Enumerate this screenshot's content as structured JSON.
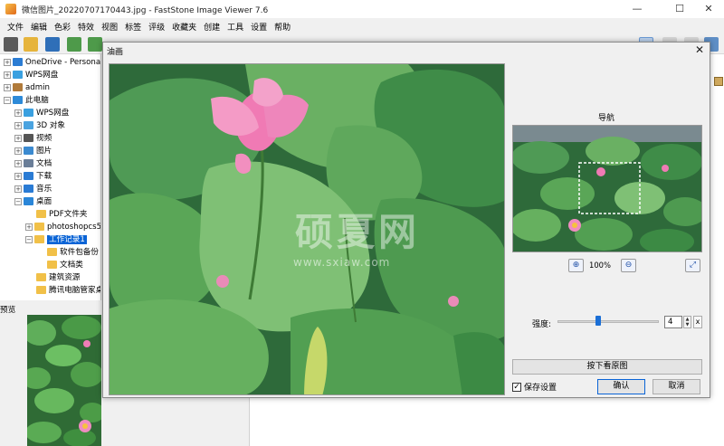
{
  "window": {
    "title": "微信图片_20220707170443.jpg  -  FastStone Image Viewer 7.6",
    "minimize": "—",
    "maximize": "☐",
    "close": "✕"
  },
  "menu": [
    "文件",
    "编辑",
    "色彩",
    "特效",
    "视图",
    "标签",
    "评级",
    "收藏夹",
    "创建",
    "工具",
    "设置",
    "帮助"
  ],
  "tree": [
    {
      "label": "OneDrive - Personal",
      "exp": "+",
      "icon": "cloud-icon",
      "color": "#2b7cd3"
    },
    {
      "label": "WPS网盘",
      "exp": "+",
      "icon": "cloud-icon",
      "color": "#3aa0e0"
    },
    {
      "label": "admin",
      "exp": "+",
      "icon": "user-icon",
      "color": "#b07a3a"
    },
    {
      "label": "此电脑",
      "exp": "−",
      "icon": "computer-icon",
      "color": "#2d8ad8"
    },
    {
      "label": "WPS网盘",
      "exp": "+",
      "icon": "cloud-icon",
      "color": "#3aa0e0"
    },
    {
      "label": "3D 对象",
      "exp": "+",
      "icon": "cube-icon",
      "color": "#4aa3e0"
    },
    {
      "label": "视频",
      "exp": "+",
      "icon": "film-icon",
      "color": "#555555"
    },
    {
      "label": "图片",
      "exp": "+",
      "icon": "picture-icon",
      "color": "#3b8ad0"
    },
    {
      "label": "文档",
      "exp": "+",
      "icon": "document-icon",
      "color": "#6a7e98"
    },
    {
      "label": "下载",
      "exp": "+",
      "icon": "download-icon",
      "color": "#2a7bd4"
    },
    {
      "label": "音乐",
      "exp": "+",
      "icon": "music-icon",
      "color": "#2a7bd4"
    },
    {
      "label": "桌面",
      "exp": "−",
      "icon": "desktop-icon",
      "color": "#2a86d8"
    },
    {
      "label": "PDF文件夹",
      "exp": "",
      "icon": "folder-icon",
      "color": "#f1c048"
    },
    {
      "label": "photoshopcs5",
      "exp": "+",
      "icon": "folder-icon",
      "color": "#f1c048"
    },
    {
      "label": "工作记录1",
      "exp": "−",
      "icon": "folder-icon",
      "color": "#f1c048",
      "selected": true
    },
    {
      "label": "软件包备份",
      "exp": "",
      "icon": "folder-icon",
      "color": "#f1c048"
    },
    {
      "label": "文档类",
      "exp": "",
      "icon": "folder-icon",
      "color": "#f1c048"
    },
    {
      "label": "建筑资源",
      "exp": "",
      "icon": "folder-icon",
      "color": "#f1c048"
    },
    {
      "label": "腾讯电脑管家桌面",
      "exp": "",
      "icon": "folder-icon",
      "color": "#f1c048"
    }
  ],
  "preview_label": "预览",
  "dialog": {
    "title": "油画",
    "close": "✕",
    "nav_title": "导航",
    "zoom_in": "⊕",
    "zoom_value": "100%",
    "zoom_out": "⊖",
    "fit_icon": "⤢",
    "strength_label": "强度:",
    "strength_value": "4",
    "strength": 4,
    "strength_max": 10,
    "spin_up": "▲",
    "spin_down": "▼",
    "clear": "x",
    "press_button": "按下看原图",
    "save_settings": "保存设置",
    "save_checked": "✓",
    "ok": "确认",
    "cancel": "取消"
  },
  "watermark": {
    "line1": "硕夏网",
    "line2": "www.sxiaw.com"
  },
  "colors": {
    "accent": "#0a64d6",
    "lotus_pink": "#f07ab4",
    "leaf_green": "#3f9a4a"
  }
}
